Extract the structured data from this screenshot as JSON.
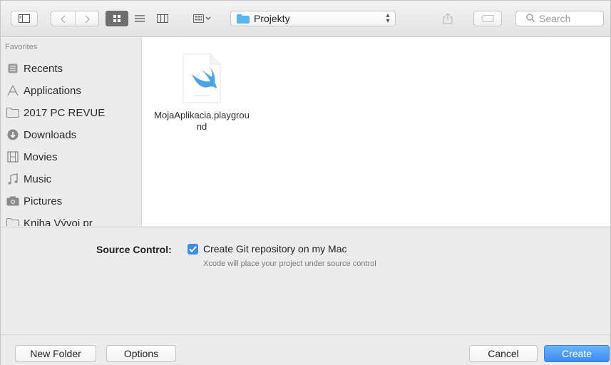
{
  "toolbar": {
    "path_label": "Projekty",
    "search_placeholder": "Search"
  },
  "sidebar": {
    "heading": "Favorites",
    "items": [
      {
        "label": "Recents",
        "icon": "recents-icon"
      },
      {
        "label": "Applications",
        "icon": "applications-icon"
      },
      {
        "label": "2017 PC REVUE",
        "icon": "folder-icon"
      },
      {
        "label": "Downloads",
        "icon": "downloads-icon"
      },
      {
        "label": "Movies",
        "icon": "movies-icon"
      },
      {
        "label": "Music",
        "icon": "music-icon"
      },
      {
        "label": "Pictures",
        "icon": "pictures-icon"
      },
      {
        "label": "Kniha Vývoj pr",
        "icon": "folder-icon"
      }
    ]
  },
  "browser": {
    "files": [
      {
        "name": "MojaAplikacia.playground",
        "icon": "swift-playground-icon"
      }
    ]
  },
  "options": {
    "source_control_label": "Source Control:",
    "git_checkbox_label": "Create Git repository on my Mac",
    "git_checked": true,
    "git_hint": "Xcode will place your project under source control"
  },
  "buttons": {
    "new_folder": "New Folder",
    "options": "Options",
    "cancel": "Cancel",
    "create": "Create"
  },
  "colors": {
    "accent": "#3b8cf5",
    "swift_orange": "#f05138",
    "swift_blue": "#4aa3e6"
  }
}
